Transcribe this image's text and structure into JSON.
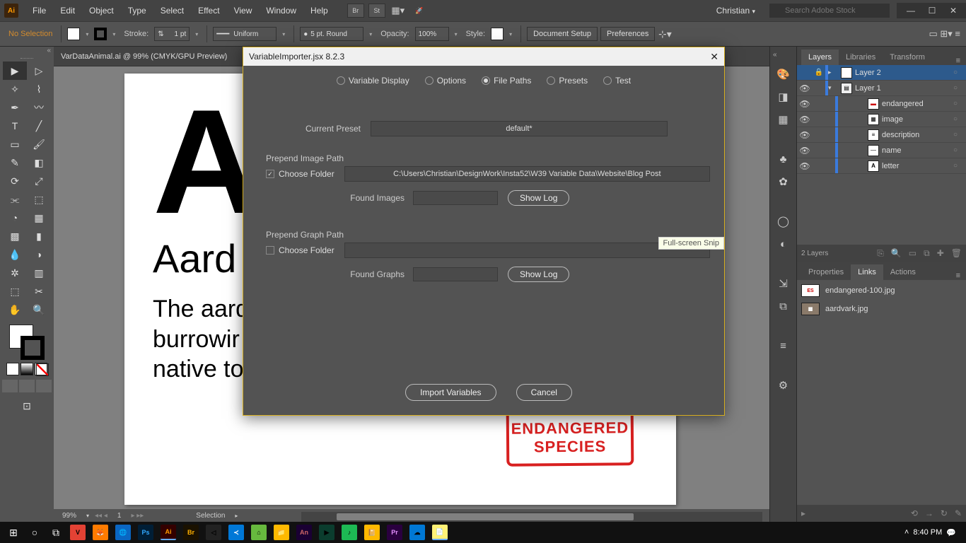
{
  "titlebar": {
    "logo": "Ai",
    "menus": [
      "File",
      "Edit",
      "Object",
      "Type",
      "Select",
      "Effect",
      "View",
      "Window",
      "Help"
    ],
    "user": "Christian",
    "search_placeholder": "Search Adobe Stock"
  },
  "ctrlbar": {
    "selection": "No Selection",
    "stroke_label": "Stroke:",
    "stroke_value": "1 pt",
    "brush_label": "Uniform",
    "point_label": "5 pt. Round",
    "opacity_label": "Opacity:",
    "opacity_value": "100%",
    "style_label": "Style:",
    "doc_setup": "Document Setup",
    "prefs": "Preferences"
  },
  "doc": {
    "tab": "VarDataAnimal.ai @ 99% (CMYK/GPU Preview)",
    "big_letter": "A",
    "title": "Aard",
    "body_l1": "The aard",
    "body_l2": "burrowir",
    "body_l3": "native to",
    "stamp_l1": "ENDANGERED",
    "stamp_l2": "SPECIES",
    "zoom": "99%",
    "artboard_nav": "1",
    "status": "Selection"
  },
  "dialog": {
    "title": "VariableImporter.jsx 8.2.3",
    "tabs": [
      "Variable Display",
      "Options",
      "File Paths",
      "Presets",
      "Test"
    ],
    "active_tab": 2,
    "preset_label": "Current Preset",
    "preset_value": "default*",
    "img_section": "Prepend Image Path",
    "choose_folder": "Choose Folder",
    "img_path": "C:\\Users\\Christian\\DesignWork\\Insta52\\W39 Variable Data\\Website\\Blog Post",
    "found_images": "Found Images",
    "graph_section": "Prepend Graph Path",
    "found_graphs": "Found Graphs",
    "show_log": "Show Log",
    "import_btn": "Import Variables",
    "cancel_btn": "Cancel",
    "tooltip": "Full-screen Snip"
  },
  "layers_panel": {
    "tabs": [
      "Layers",
      "Libraries",
      "Transform"
    ],
    "rows": [
      {
        "name": "Layer 2",
        "color": "#3b7bdc",
        "type": "layer",
        "locked": true,
        "expanded": false,
        "selected": true
      },
      {
        "name": "Layer 1",
        "color": "#3b7bdc",
        "type": "layer",
        "expanded": true
      },
      {
        "name": "endangered",
        "color": "#3b7bdc",
        "type": "item"
      },
      {
        "name": "image",
        "color": "#3b7bdc",
        "type": "item"
      },
      {
        "name": "description",
        "color": "#3b7bdc",
        "type": "item"
      },
      {
        "name": "name",
        "color": "#3b7bdc",
        "type": "item"
      },
      {
        "name": "letter",
        "color": "#3b7bdc",
        "type": "item"
      }
    ],
    "footer": "2 Layers"
  },
  "links_panel": {
    "tabs": [
      "Properties",
      "Links",
      "Actions"
    ],
    "items": [
      "endangered-100.jpg",
      "aardvark.jpg"
    ]
  },
  "taskbar": {
    "time": "8:40 PM"
  }
}
